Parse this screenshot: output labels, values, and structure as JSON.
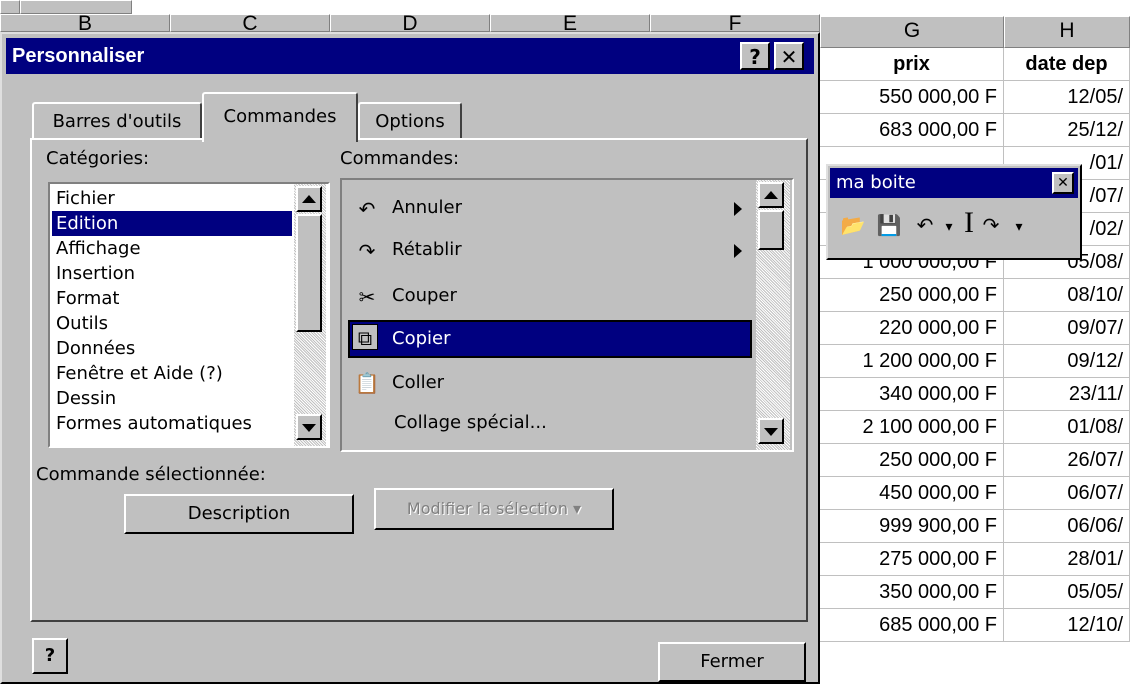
{
  "spreadsheet": {
    "columns": [
      "B",
      "C",
      "D",
      "E",
      "F",
      "G",
      "H"
    ],
    "col_g_values": [
      "prix",
      "550 000,00 F",
      "683 000,00 F",
      "",
      "",
      "",
      "1 000 000,00 F",
      "250 000,00 F",
      "220 000,00 F",
      "1 200 000,00 F",
      "340 000,00 F",
      "2 100 000,00 F",
      "250 000,00 F",
      "450 000,00 F",
      "999 900,00 F",
      "275 000,00 F",
      "350 000,00 F",
      "685 000,00 F"
    ],
    "col_h_values": [
      "date dep",
      "12/05/",
      "25/12/",
      "/01/",
      "/07/",
      "/02/",
      "05/08/",
      "08/10/",
      "09/07/",
      "09/12/",
      "23/11/",
      "01/08/",
      "26/07/",
      "06/07/",
      "06/06/",
      "28/01/",
      "05/05/",
      "12/10/"
    ]
  },
  "dialog": {
    "title": "Personnaliser",
    "help_btn": "?",
    "close_btn": "✕",
    "tabs": [
      {
        "label": "Barres d'outils"
      },
      {
        "label": "Commandes"
      },
      {
        "label": "Options"
      }
    ],
    "categories_label": "Catégories:",
    "commands_label": "Commandes:",
    "categories": [
      "Fichier",
      "Edition",
      "Affichage",
      "Insertion",
      "Format",
      "Outils",
      "Données",
      "Fenêtre et Aide (?)",
      "Dessin",
      "Formes automatiques"
    ],
    "selected_category": "Edition",
    "commands": [
      {
        "label": "Annuler",
        "icon": "undo-icon",
        "glyph": "↶"
      },
      {
        "label": "Rétablir",
        "icon": "redo-icon",
        "glyph": "↷"
      },
      {
        "label": "Couper",
        "icon": "scissors-icon",
        "glyph": "✂"
      },
      {
        "label": "Copier",
        "icon": "copy-icon",
        "glyph": "⧉"
      },
      {
        "label": "Coller",
        "icon": "paste-icon",
        "glyph": "📋"
      },
      {
        "label": "Collage spécial...",
        "icon": "",
        "glyph": ""
      }
    ],
    "selected_command": "Copier",
    "selected_cmd_label": "Commande sélectionnée:",
    "description_btn": "Description",
    "modify_btn": "Modifier la sélection ▾",
    "close_label": "Fermer",
    "help_icon_glyph": "?"
  },
  "floating_toolbar": {
    "title": "ma boite",
    "close": "✕",
    "buttons": [
      {
        "name": "open-folder-icon",
        "glyph": "📂"
      },
      {
        "name": "save-icon",
        "glyph": "💾"
      },
      {
        "name": "undo-icon",
        "glyph": "↶"
      },
      {
        "name": "dropdown-arrow-icon",
        "glyph": "▾"
      },
      {
        "name": "ibeam-cursor-icon",
        "glyph": "I"
      },
      {
        "name": "redo-icon",
        "glyph": "↷"
      },
      {
        "name": "dropdown-arrow-icon",
        "glyph": "▾"
      }
    ]
  }
}
